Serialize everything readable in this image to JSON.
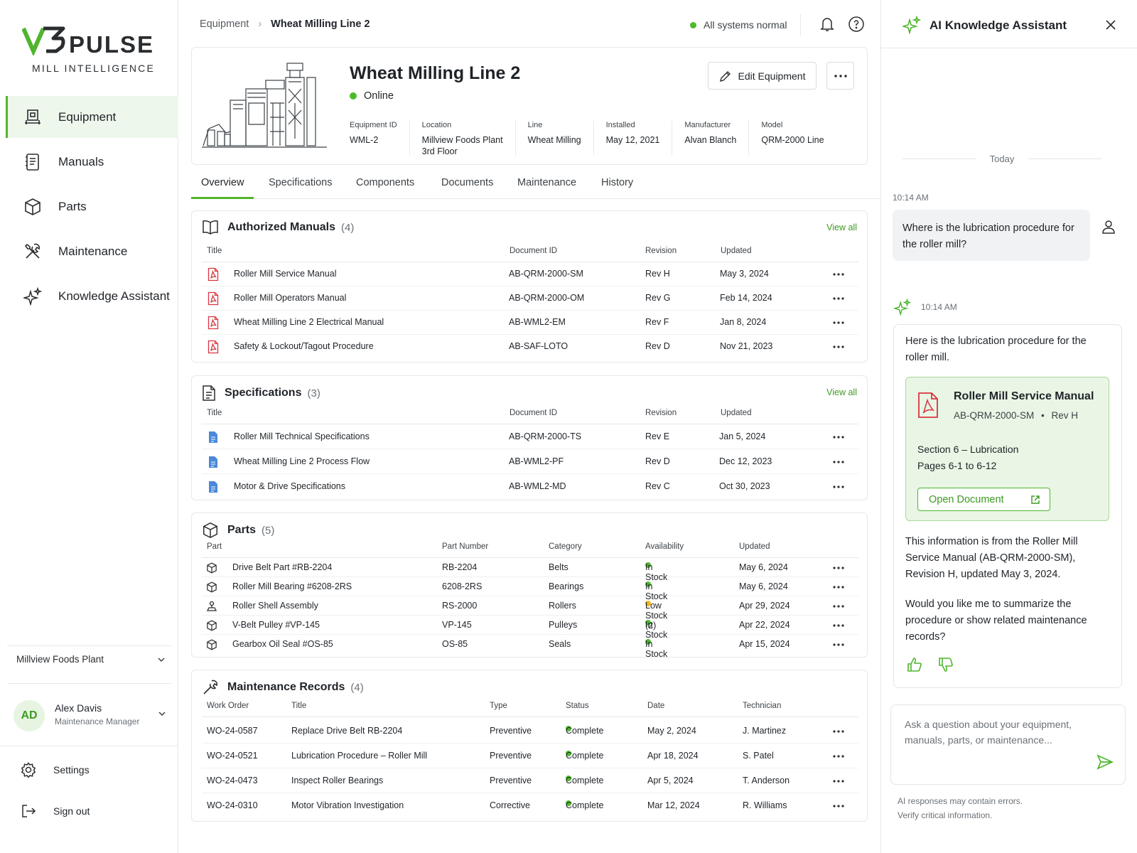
{
  "colors": {
    "accent": "#4fb52e",
    "accent_text": "#3e9a22",
    "status_ok": "#4cbb2b",
    "status_low": "#f0b81a",
    "pdf_red": "#d9363e",
    "doc_blue": "#4a88d8"
  },
  "brand": {
    "name": "PULSE",
    "tagline": "MILL INTELLIGENCE",
    "mark_icon": "vs-logo-mark"
  },
  "sidebar": {
    "items": [
      {
        "label": "Equipment",
        "icon": "equipment-icon"
      },
      {
        "label": "Manuals",
        "icon": "manual-icon"
      },
      {
        "label": "Parts",
        "icon": "box-icon"
      },
      {
        "label": "Maintenance",
        "icon": "tools-icon"
      },
      {
        "label": "Knowledge Assistant",
        "icon": "sparkle-icon"
      }
    ],
    "plant": "Millview Foods Plant",
    "user": {
      "initials": "AD",
      "name": "Alex Davis",
      "role": "Maintenance Manager"
    },
    "settings": "Settings",
    "signout": "Sign out"
  },
  "header": {
    "breadcrumb": [
      "Equipment",
      "Wheat Milling Line 2"
    ],
    "status": "All systems normal"
  },
  "equipment": {
    "title": "Wheat Milling Line 2",
    "status": "Online",
    "edit_label": "Edit Equipment",
    "fields": [
      {
        "k": "Equipment ID",
        "v": "WML-2"
      },
      {
        "k": "Location",
        "v": "Millview Foods Plant\n3rd Floor"
      },
      {
        "k": "Line",
        "v": "Wheat Milling"
      },
      {
        "k": "Installed",
        "v": "May 12, 2021"
      },
      {
        "k": "Manufacturer",
        "v": "Alvan Blanch"
      },
      {
        "k": "Model",
        "v": "QRM-2000 Line"
      }
    ]
  },
  "tabs": [
    "Overview",
    "Specifications",
    "Components",
    "Documents",
    "Maintenance",
    "History"
  ],
  "manuals": {
    "title": "Authorized Manuals",
    "count": "(4)",
    "view_all": "View all",
    "columns": [
      "Title",
      "Document ID",
      "Revision",
      "Updated"
    ],
    "rows": [
      {
        "title": "Roller Mill Service Manual",
        "id": "AB-QRM-2000-SM",
        "rev": "Rev H",
        "updated": "May 3, 2024"
      },
      {
        "title": "Roller Mill Operators Manual",
        "id": "AB-QRM-2000-OM",
        "rev": "Rev G",
        "updated": "Feb 14, 2024"
      },
      {
        "title": "Wheat Milling Line 2 Electrical Manual",
        "id": "AB-WML2-EM",
        "rev": "Rev F",
        "updated": "Jan 8, 2024"
      },
      {
        "title": "Safety & Lockout/Tagout Procedure",
        "id": "AB-SAF-LOTO",
        "rev": "Rev D",
        "updated": "Nov 21, 2023"
      }
    ]
  },
  "specs": {
    "title": "Specifications",
    "count": "(3)",
    "view_all": "View all",
    "columns": [
      "Title",
      "Document ID",
      "Revision",
      "Updated"
    ],
    "rows": [
      {
        "title": "Roller Mill Technical Specifications",
        "id": "AB-QRM-2000-TS",
        "rev": "Rev E",
        "updated": "Jan 5, 2024"
      },
      {
        "title": "Wheat Milling Line 2 Process Flow",
        "id": "AB-WML2-PF",
        "rev": "Rev D",
        "updated": "Dec 12, 2023"
      },
      {
        "title": "Motor & Drive Specifications",
        "id": "AB-WML2-MD",
        "rev": "Rev C",
        "updated": "Oct 30, 2023"
      }
    ]
  },
  "parts": {
    "title": "Parts",
    "count": "(5)",
    "columns": [
      "Part",
      "Part Number",
      "Category",
      "Availability",
      "Updated"
    ],
    "rows": [
      {
        "part": "Drive Belt Part #RB-2204",
        "num": "RB-2204",
        "cat": "Belts",
        "avail": "In Stock",
        "level": "ok",
        "updated": "May 6, 2024",
        "icon": "box-icon"
      },
      {
        "part": "Roller Mill Bearing #6208-2RS",
        "num": "6208-2RS",
        "cat": "Bearings",
        "avail": "In Stock",
        "level": "ok",
        "updated": "May 6, 2024",
        "icon": "box-icon"
      },
      {
        "part": "Roller Shell Assembly",
        "num": "RS-2000",
        "cat": "Rollers",
        "avail": "Low Stock (2)",
        "level": "low",
        "updated": "Apr 29, 2024",
        "icon": "assembly-icon"
      },
      {
        "part": "V-Belt Pulley #VP-145",
        "num": "VP-145",
        "cat": "Pulleys",
        "avail": "In Stock",
        "level": "ok",
        "updated": "Apr 22, 2024",
        "icon": "box-icon"
      },
      {
        "part": "Gearbox Oil Seal #OS-85",
        "num": "OS-85",
        "cat": "Seals",
        "avail": "In Stock",
        "level": "ok",
        "updated": "Apr 15, 2024",
        "icon": "box-icon"
      }
    ]
  },
  "maintenance": {
    "title": "Maintenance Records",
    "count": "(4)",
    "columns": [
      "Work Order",
      "Title",
      "Type",
      "Status",
      "Date",
      "Technician"
    ],
    "rows": [
      {
        "wo": "WO-24-0587",
        "title": "Replace Drive Belt RB-2204",
        "type": "Preventive",
        "status": "Complete",
        "date": "May 2, 2024",
        "tech": "J. Martinez"
      },
      {
        "wo": "WO-24-0521",
        "title": "Lubrication Procedure – Roller Mill",
        "type": "Preventive",
        "status": "Complete",
        "date": "Apr 18, 2024",
        "tech": "S. Patel"
      },
      {
        "wo": "WO-24-0473",
        "title": "Inspect Roller Bearings",
        "type": "Preventive",
        "status": "Complete",
        "date": "Apr 5, 2024",
        "tech": "T. Anderson"
      },
      {
        "wo": "WO-24-0310",
        "title": "Motor Vibration Investigation",
        "type": "Corrective",
        "status": "Complete",
        "date": "Mar 12, 2024",
        "tech": "R. Williams"
      }
    ]
  },
  "assistant": {
    "title": "AI Knowledge Assistant",
    "day": "Today",
    "user_time": "10:14 AM",
    "user_msg": "Where is the lubrication procedure for the roller mill?",
    "bot_time": "10:14 AM",
    "bot_intro": "Here is the lubrication procedure for the roller mill.",
    "doc": {
      "title": "Roller Mill Service Manual",
      "id": "AB-QRM-2000-SM",
      "sep": "•",
      "rev": "Rev H",
      "section": "Section 6 – Lubrication",
      "pages": "Pages 6-1 to 6-12",
      "open_label": "Open Document"
    },
    "bot_source": "This information is from the Roller Mill Service Manual (AB-QRM-2000-SM), Revision H, updated May 3, 2024.",
    "bot_followup": "Would you like me to summarize the procedure or show related maintenance records?",
    "input_placeholder": "Ask a question about your equipment, manuals, parts, or maintenance...",
    "disclaimer": [
      "AI responses may contain errors.",
      "Verify critical information."
    ]
  }
}
